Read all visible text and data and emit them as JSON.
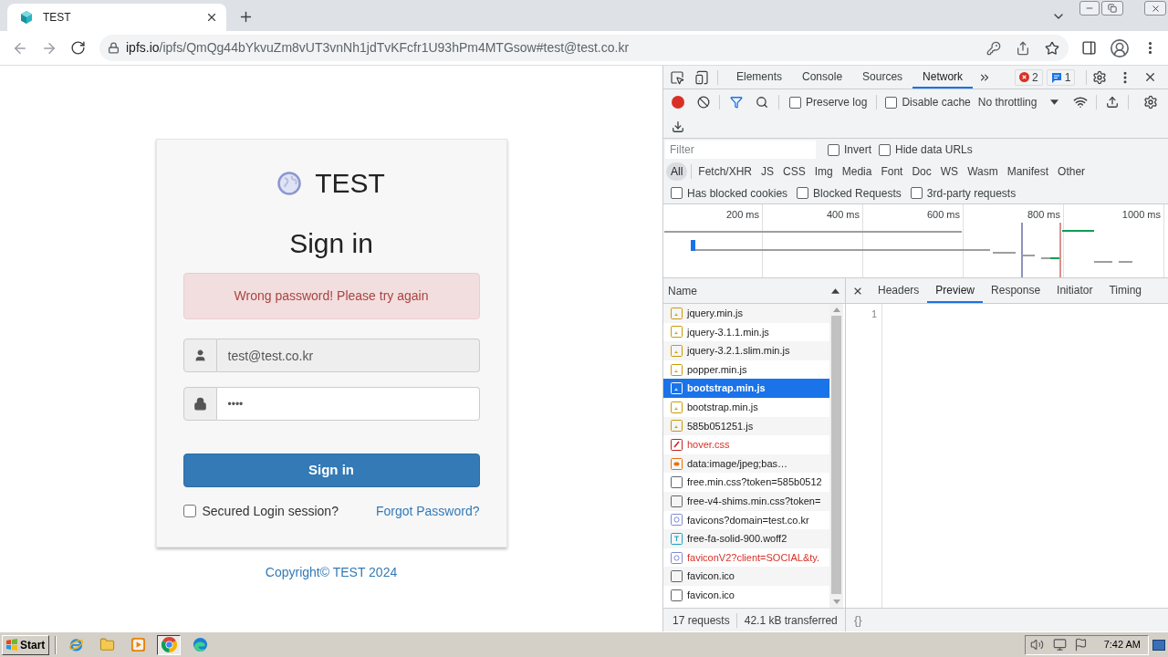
{
  "browser": {
    "tabs": [
      {
        "title": "TEST",
        "selected": true
      }
    ],
    "address": {
      "domain": "ipfs.io",
      "path": "/ipfs/QmQg44bYkvuZm8vUT3vnNh1jdTvKFcfr1U93hPm4MTGsow#test@test.co.kr"
    }
  },
  "page": {
    "brand": "TEST",
    "heading": "Sign in",
    "alert": "Wrong password! Please try again",
    "email": {
      "value": "test@test.co.kr",
      "disabled": true
    },
    "password": {
      "value": "••••",
      "disabled": false
    },
    "submit": "Sign in",
    "secured_session": {
      "label": "Secured Login session?",
      "checked": false
    },
    "forgot_password": "Forgot Password?",
    "footer": "Copyright© TEST 2024"
  },
  "devtools": {
    "panel_tabs": [
      {
        "label": "Elements",
        "selected": false
      },
      {
        "label": "Console",
        "selected": false
      },
      {
        "label": "Sources",
        "selected": false
      },
      {
        "label": "Network",
        "selected": true
      }
    ],
    "error_count": "2",
    "message_count": "1",
    "recording": true,
    "preserve_log": {
      "label": "Preserve log",
      "checked": false
    },
    "disable_cache": {
      "label": "Disable cache",
      "checked": false
    },
    "throttling": "No throttling",
    "filter": {
      "placeholder": "Filter"
    },
    "invert": {
      "label": "Invert",
      "checked": false
    },
    "hide_data_urls": {
      "label": "Hide data URLs",
      "checked": false
    },
    "type_filters": [
      {
        "label": "All",
        "selected": true
      },
      {
        "label": "Fetch/XHR",
        "selected": false
      },
      {
        "label": "JS",
        "selected": false
      },
      {
        "label": "CSS",
        "selected": false
      },
      {
        "label": "Img",
        "selected": false
      },
      {
        "label": "Media",
        "selected": false
      },
      {
        "label": "Font",
        "selected": false
      },
      {
        "label": "Doc",
        "selected": false
      },
      {
        "label": "WS",
        "selected": false
      },
      {
        "label": "Wasm",
        "selected": false
      },
      {
        "label": "Manifest",
        "selected": false
      },
      {
        "label": "Other",
        "selected": false
      }
    ],
    "extra_filters": [
      {
        "label": "Has blocked cookies",
        "checked": false
      },
      {
        "label": "Blocked Requests",
        "checked": false
      },
      {
        "label": "3rd-party requests",
        "checked": false
      }
    ],
    "timeline": {
      "ticks": [
        "200 ms",
        "400 ms",
        "600 ms",
        "800 ms",
        "1000 ms"
      ]
    },
    "requests": {
      "column": "Name",
      "rows": [
        {
          "name": "jquery.min.js",
          "kind": "script",
          "error": false,
          "selected": false
        },
        {
          "name": "jquery-3.1.1.min.js",
          "kind": "script",
          "error": false,
          "selected": false
        },
        {
          "name": "jquery-3.2.1.slim.min.js",
          "kind": "script",
          "error": false,
          "selected": false
        },
        {
          "name": "popper.min.js",
          "kind": "script",
          "error": false,
          "selected": false
        },
        {
          "name": "bootstrap.min.js",
          "kind": "script",
          "error": false,
          "selected": true
        },
        {
          "name": "bootstrap.min.js",
          "kind": "script",
          "error": false,
          "selected": false
        },
        {
          "name": "585b051251.js",
          "kind": "script",
          "error": false,
          "selected": false
        },
        {
          "name": "hover.css",
          "kind": "stylesheet",
          "error": true,
          "selected": false
        },
        {
          "name": "data:image/jpeg;bas…",
          "kind": "image-preview",
          "error": false,
          "selected": false
        },
        {
          "name": "free.min.css?token=585b0512",
          "kind": "other",
          "error": false,
          "selected": false
        },
        {
          "name": "free-v4-shims.min.css?token=",
          "kind": "other",
          "error": false,
          "selected": false
        },
        {
          "name": "favicons?domain=test.co.kr",
          "kind": "image",
          "error": false,
          "selected": false
        },
        {
          "name": "free-fa-solid-900.woff2",
          "kind": "font",
          "error": false,
          "selected": false
        },
        {
          "name": "faviconV2?client=SOCIAL&ty.",
          "kind": "image",
          "error": true,
          "selected": false
        },
        {
          "name": "favicon.ico",
          "kind": "other",
          "error": false,
          "selected": false
        },
        {
          "name": "favicon.ico",
          "kind": "other",
          "error": false,
          "selected": false
        }
      ]
    },
    "detail_tabs": [
      {
        "label": "Headers",
        "selected": false
      },
      {
        "label": "Preview",
        "selected": true
      },
      {
        "label": "Response",
        "selected": false
      },
      {
        "label": "Initiator",
        "selected": false
      },
      {
        "label": "Timing",
        "selected": false
      }
    ],
    "preview": {
      "line_numbers": [
        "1"
      ]
    },
    "status_bar": {
      "requests": "17 requests",
      "transferred": "42.1 kB transferred",
      "format_button": "{}"
    }
  },
  "taskbar": {
    "start": "Start",
    "apps": [
      {
        "kind": "ie",
        "active": false
      },
      {
        "kind": "folder",
        "active": false
      },
      {
        "kind": "media",
        "active": false
      },
      {
        "kind": "chrome",
        "active": true
      },
      {
        "kind": "edge",
        "active": false
      }
    ],
    "clock": "7:42 AM"
  }
}
